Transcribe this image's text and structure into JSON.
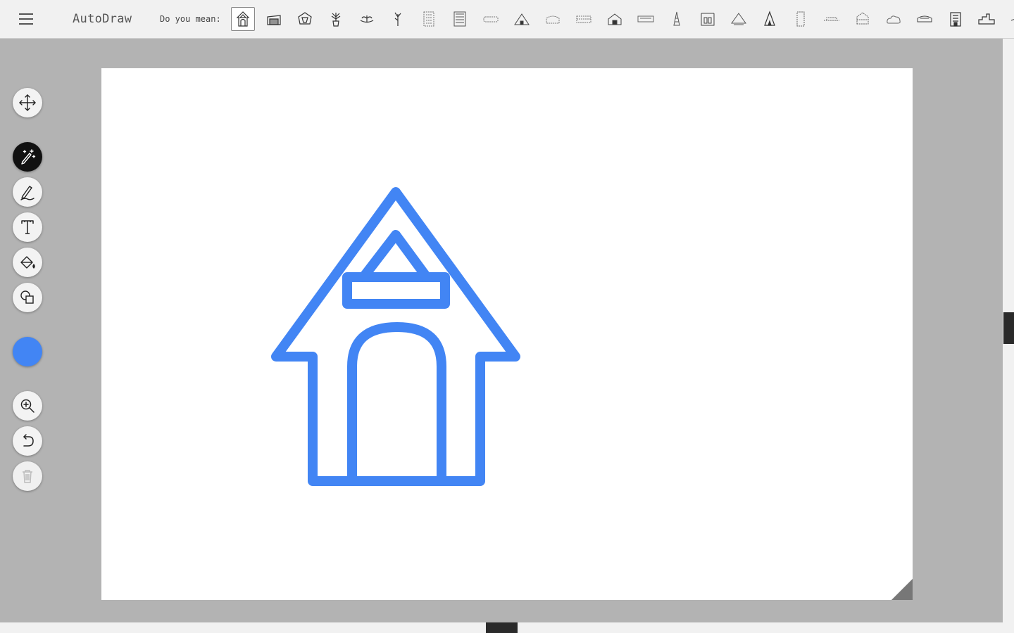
{
  "app": {
    "title": "AutoDraw"
  },
  "suggestions": {
    "label": "Do you mean:",
    "items": [
      "house-icon",
      "shed-icon",
      "birdhouse-icon",
      "plant-pot-icon",
      "plant-icon",
      "tree-icon",
      "building-icon",
      "tower-block-icon",
      "bus-icon",
      "hut-icon",
      "cake-icon",
      "train-icon",
      "barn-icon",
      "truck-icon",
      "lighthouse-icon",
      "castle-icon",
      "tent-icon",
      "teepee-icon",
      "skyscraper-icon",
      "bridge-icon",
      "temple-icon",
      "cloud-icon",
      "car-icon",
      "apartment-icon",
      "city-icon",
      "boat-icon"
    ]
  },
  "tools": [
    {
      "name": "move-tool",
      "icon": "move-arrows-icon"
    },
    {
      "name": "autodraw-tool",
      "icon": "magic-pencil-icon",
      "active": true
    },
    {
      "name": "draw-tool",
      "icon": "pencil-icon"
    },
    {
      "name": "type-tool",
      "icon": "text-icon"
    },
    {
      "name": "fill-tool",
      "icon": "paint-bucket-icon"
    },
    {
      "name": "shape-tool",
      "icon": "shapes-icon"
    },
    {
      "name": "zoom-tool",
      "icon": "zoom-in-icon"
    },
    {
      "name": "undo-tool",
      "icon": "undo-icon"
    },
    {
      "name": "delete-tool",
      "icon": "trash-icon",
      "disabled": true
    }
  ],
  "colors": {
    "current_stroke": "#4285f4",
    "topbar_bg": "#f1f1f1",
    "workspace_bg": "#b3b3b3",
    "canvas_bg": "#ffffff"
  },
  "drawing": {
    "subject": "doghouse-icon",
    "stroke_color": "#4285f4"
  }
}
